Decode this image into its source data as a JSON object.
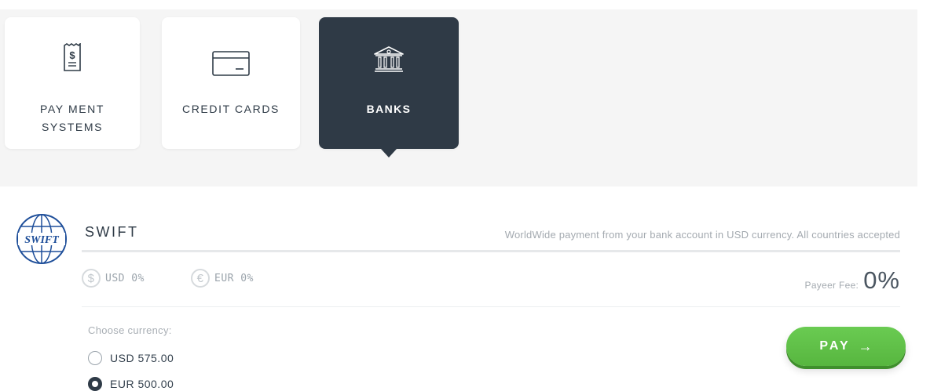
{
  "tabs": [
    {
      "label": "PAY MENT\nSYSTEMS",
      "icon": "receipt-dollar-icon",
      "active": false
    },
    {
      "label": "CREDIT CARDS",
      "icon": "credit-card-icon",
      "active": false
    },
    {
      "label": "BANKS",
      "icon": "bank-building-icon",
      "active": true
    }
  ],
  "method": {
    "logo_text": "SWIFT",
    "name": "SWIFT",
    "description": "WorldWide payment from your bank account in USD currency. All countries accepted"
  },
  "fees": {
    "usd_symbol": "$",
    "usd_label": "USD 0%",
    "eur_symbol": "€",
    "eur_label": "EUR 0%",
    "payeer_label": "Payeer Fee:",
    "payeer_value": "0%"
  },
  "currency": {
    "choose_label": "Choose currency:",
    "options": [
      {
        "label": "USD 575.00",
        "selected": false
      },
      {
        "label": "EUR 500.00",
        "selected": true
      }
    ]
  },
  "pay_button": {
    "label": "PAY",
    "arrow": "→"
  },
  "colors": {
    "tab_active_bg": "#2f3a46",
    "pay_green": "#5cbf45",
    "band_bg": "#f5f5f5"
  }
}
